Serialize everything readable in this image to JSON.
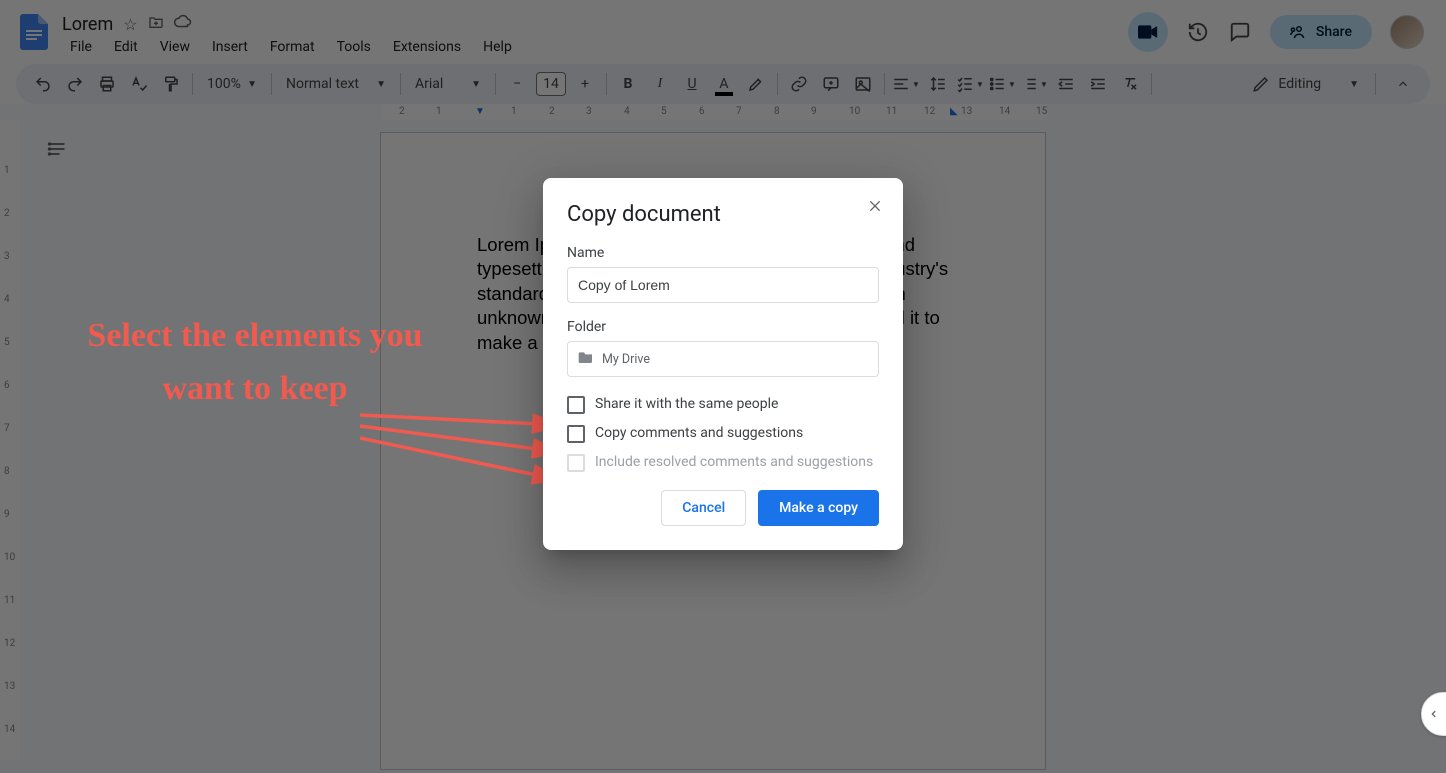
{
  "doc": {
    "title": "Lorem",
    "body": "Lorem Ipsum is simply dummy text of the printing and typesetting industry. Lorem Ipsum has been the industry's standard dummy text ever since the 1500s, when an unknown printer took a galley of type and scrambled it to make a it"
  },
  "menubar": [
    "File",
    "Edit",
    "View",
    "Insert",
    "Format",
    "Tools",
    "Extensions",
    "Help"
  ],
  "toolbar": {
    "zoom": "100%",
    "style": "Normal text",
    "font": "Arial",
    "font_size": "14",
    "mode": "Editing"
  },
  "header": {
    "share": "Share"
  },
  "ruler": {
    "h_nums": [
      "2",
      "1",
      "1",
      "2",
      "3",
      "4",
      "5",
      "6",
      "7",
      "8",
      "9",
      "10",
      "11",
      "12",
      "13",
      "14",
      "15"
    ],
    "v_nums": [
      "1",
      "2",
      "3",
      "4",
      "5",
      "6",
      "7",
      "8",
      "9",
      "10",
      "11",
      "12",
      "13",
      "14"
    ]
  },
  "dialog": {
    "title": "Copy document",
    "name_label": "Name",
    "name_value": "Copy of Lorem",
    "folder_label": "Folder",
    "folder_value": "My Drive",
    "opt_share": "Share it with the same people",
    "opt_comments": "Copy comments and suggestions",
    "opt_resolved": "Include resolved comments and suggestions",
    "cancel": "Cancel",
    "confirm": "Make a copy"
  },
  "annotation": {
    "text": "Select the elements you want to keep"
  }
}
